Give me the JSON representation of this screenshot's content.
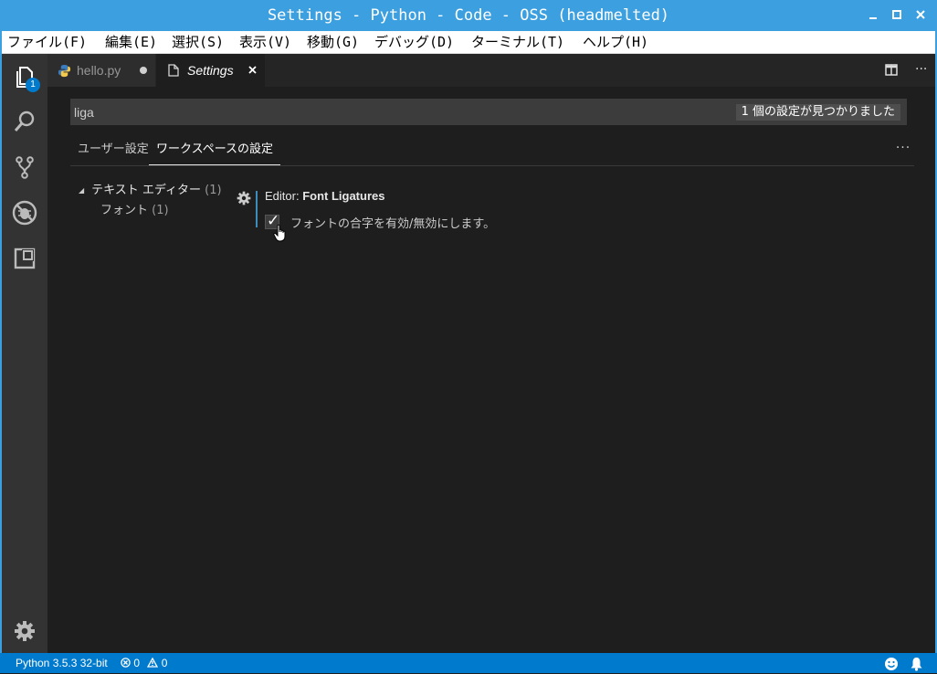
{
  "window": {
    "title": "Settings - Python - Code - OSS (headmelted)",
    "controls": [
      "minimize",
      "maximize",
      "close"
    ]
  },
  "menubar": {
    "items": [
      {
        "label": "ファイル(F)"
      },
      {
        "label": "編集(E)"
      },
      {
        "label": "選択(S)"
      },
      {
        "label": "表示(V)"
      },
      {
        "label": "移動(G)"
      },
      {
        "label": "デバッグ(D)"
      },
      {
        "label": "ターミナル(T)"
      },
      {
        "label": "ヘルプ(H)"
      }
    ]
  },
  "activitybar": {
    "items": [
      {
        "icon": "explorer-icon",
        "badge": "1"
      },
      {
        "icon": "search-icon"
      },
      {
        "icon": "source-control-icon"
      },
      {
        "icon": "debug-icon"
      },
      {
        "icon": "extensions-icon"
      }
    ],
    "bottom_icon": "manage-gear-icon"
  },
  "tabs": [
    {
      "label": "hello.py",
      "icon": "python-file-icon",
      "modified": true
    },
    {
      "label": "Settings",
      "icon": "file-icon",
      "active": true
    }
  ],
  "settings": {
    "search_value": "liga",
    "result_count": "1 個の設定が見つかりました",
    "scope_tabs": [
      {
        "label": "ユーザー設定",
        "active": false
      },
      {
        "label": "ワークスペースの設定",
        "active": true
      }
    ],
    "toc": {
      "group_label": "テキスト エディター",
      "group_count": "(1)",
      "child_label": "フォント",
      "child_count": "(1)"
    },
    "item": {
      "category": "Editor: ",
      "key": "Font Ligatures",
      "description": "フォントの合字を有効/無効にします。",
      "checked": true
    }
  },
  "statusbar": {
    "python": "Python 3.5.3 32-bit",
    "errors": "0",
    "warnings": "0"
  },
  "colors": {
    "titlebar": "#3c9fdf",
    "statusbar": "#007acc",
    "editor_bg": "#1e1e1e",
    "activitybar": "#333333"
  }
}
